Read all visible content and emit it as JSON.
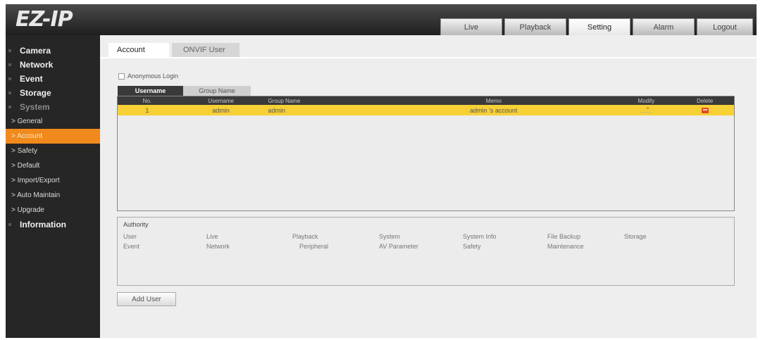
{
  "header": {
    "logo": "EZ-IP",
    "tabs": [
      {
        "label": "Live"
      },
      {
        "label": "Playback"
      },
      {
        "label": "Setting"
      },
      {
        "label": "Alarm"
      },
      {
        "label": "Logout"
      }
    ],
    "active_tab": "Setting"
  },
  "sidebar": {
    "sections": [
      {
        "label": "Camera"
      },
      {
        "label": "Network"
      },
      {
        "label": "Event"
      },
      {
        "label": "Storage"
      },
      {
        "label": "System"
      }
    ],
    "system_items": [
      {
        "label": "> General"
      },
      {
        "label": "> Account"
      },
      {
        "label": "> Safety"
      },
      {
        "label": "> Default"
      },
      {
        "label": "> Import/Export"
      },
      {
        "label": "> Auto Maintain"
      },
      {
        "label": "> Upgrade"
      }
    ],
    "information": "Information"
  },
  "main": {
    "tabs": [
      {
        "label": "Account"
      },
      {
        "label": "ONVIF User"
      }
    ],
    "anonymous_login_label": "Anonymous Login",
    "anonymous_login_checked": false,
    "list_tabs": [
      {
        "label": "Username"
      },
      {
        "label": "Group Name"
      }
    ],
    "table": {
      "columns": [
        "No.",
        "Username",
        "Group Name",
        "Memo",
        "Modify",
        "Delete"
      ],
      "rows": [
        {
          "no": "1",
          "username": "admin",
          "group": "admin",
          "memo": "admin 's account"
        }
      ]
    },
    "authority": {
      "title": "Authority",
      "row1": [
        "User",
        "Live",
        "Playback",
        "System",
        "System Info",
        "File Backup",
        "Storage"
      ],
      "row2": [
        "Event",
        "Network",
        "Peripheral",
        "AV Parameter",
        "Safety",
        "Maintenance"
      ]
    },
    "add_user_label": "Add User"
  },
  "colors": {
    "accent_orange": "#f08a1c",
    "selected_row_yellow": "#f7d035",
    "delete_red": "#e24a2b",
    "sidebar_bg": "#262626"
  },
  "icons": [
    "pencil-icon",
    "trash-icon",
    "checkbox-icon"
  ]
}
